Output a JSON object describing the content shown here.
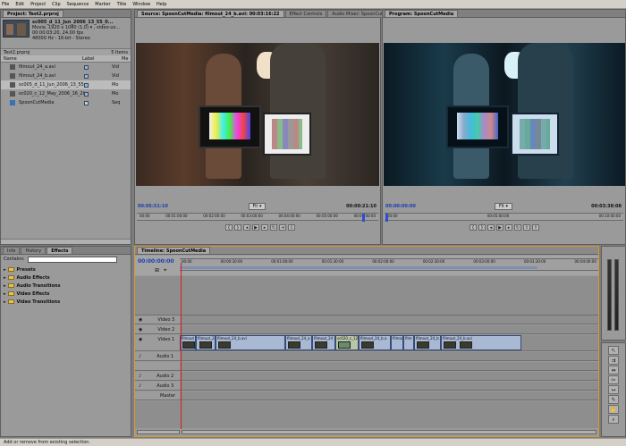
{
  "menu": [
    "File",
    "Edit",
    "Project",
    "Clip",
    "Sequence",
    "Marker",
    "Title",
    "Window",
    "Help"
  ],
  "project": {
    "tab": "Project: Test2.prproj",
    "clip_name": "sc005_d_11_Jun_2006_13_55_0...",
    "clip_info1": "Movie, 1920 x 1080 (1.0)  ▾ , video-us...",
    "clip_info2": "00:00:03:20, 24.00 fps",
    "clip_info3": "48000 Hz - 16-bit - Stereo",
    "file": "Test2.prproj",
    "count": "5 Items",
    "col_name": "Name",
    "col_label": "Label",
    "col_media": "Me",
    "items": [
      {
        "name": "filmout_24_a.avi",
        "media": "Vid"
      },
      {
        "name": "filmout_24_b.avi",
        "media": "Vid"
      },
      {
        "name": "sc005_d_11_Jun_2006_13_55",
        "media": "Mo"
      },
      {
        "name": "sc020_c_12_May_2006_16_20",
        "media": "Mo"
      },
      {
        "name": "SpoonCutMedia",
        "media": "Seq"
      }
    ]
  },
  "effects": {
    "tabs": [
      "Info",
      "History",
      "Effects"
    ],
    "contains_label": "Contains:",
    "folders": [
      "Presets",
      "Audio Effects",
      "Audio Transitions",
      "Video Effects",
      "Video Transitions"
    ]
  },
  "source": {
    "tabs": [
      "Source: SpoonCutMedia: filmout_24_b.avi: 00:03:16:22",
      "Effect Controls",
      "Audio Mixer: SpoonCutMedia"
    ],
    "tc_left": "00:05:51:10",
    "fit": "Fit",
    "tc_right": "00:00:21:10",
    "ruler": [
      "00:00",
      "00:01:00:00",
      "00:02:00:00",
      "00:03:00:00",
      "00:04:00:00",
      "00:05:00:00",
      "00:06:00:00"
    ]
  },
  "program": {
    "tab": "Program: SpoonCutMedia",
    "tc_left": "00:00:00:00",
    "fit": "Fit",
    "tc_right": "00:03:38:08",
    "ruler": [
      "00:00",
      "00:05:00:00",
      "00:10:00:00"
    ]
  },
  "timeline": {
    "tab": "Timeline: SpoonCutMedia",
    "tc": "00:00:00:00",
    "ruler": [
      "00:00",
      "00:00:30:00",
      "00:01:00:00",
      "00:01:30:00",
      "00:02:00:00",
      "00:02:30:00",
      "00:03:00:00",
      "00:03:30:00",
      "00:04:00:00"
    ],
    "video_tracks": [
      "Video 3",
      "Video 2",
      "Video 1"
    ],
    "audio_tracks": [
      "Audio 1",
      "Audio 2",
      "Audio 3",
      "Master"
    ],
    "clips": [
      "filmout",
      "filmout_24",
      "filmout_24_b.avi",
      "filmout_24_a",
      "filmout_24",
      "sc020_c_12",
      "filmout_24_b.a",
      "filmout",
      "film",
      "filmout_24_b",
      "filmout_24_b.avi"
    ]
  },
  "status": "Add or remove from existing selection."
}
